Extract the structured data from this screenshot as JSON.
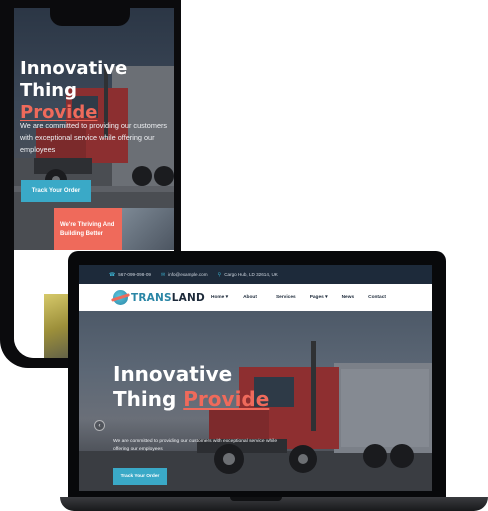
{
  "phone": {
    "hero_title_line1": "Innovative Thing",
    "hero_title_accent": "Provide",
    "hero_description": "We are committed to providing our customers with exceptional service while offering our employees",
    "cta_label": "Track Your Order",
    "card_label": "We're Thriving And Building Better"
  },
  "laptop": {
    "topbar": {
      "phone": "567-099-098-09",
      "email": "info@example.com",
      "address": "Cargo Hub, LD 32614, UK",
      "phone_icon": "phone-icon",
      "email_icon": "mail-icon",
      "address_icon": "location-icon"
    },
    "logo": {
      "part1": "TRANS",
      "part2": "LAND"
    },
    "nav": [
      {
        "label": "Home",
        "dropdown": true
      },
      {
        "label": "About",
        "dropdown": false
      },
      {
        "label": "Services",
        "dropdown": false
      },
      {
        "label": "Pages",
        "dropdown": true
      },
      {
        "label": "News",
        "dropdown": false
      },
      {
        "label": "Contact",
        "dropdown": false
      }
    ],
    "hero_title_line1": "Innovative",
    "hero_title_line2": "Thing",
    "hero_title_accent": "Provide",
    "hero_description": "We are committed to providing our customers with exceptional service while offering our employees",
    "cta_label": "Track Your Order",
    "prev_arrow_icon": "chevron-left-icon"
  },
  "colors": {
    "accent": "#ef6a5b",
    "brand": "#3aa9c7",
    "topbar": "#1d2a3a"
  }
}
